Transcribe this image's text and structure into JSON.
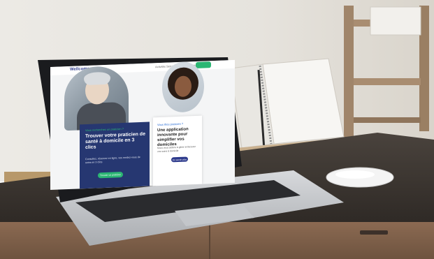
{
  "screen": {
    "logo": "Wellcome",
    "nav_links": "Activités  Services  Nous Rejoindre",
    "card_left": {
      "eyebrow": "Vous recherchez un praticien ?",
      "title": "Trouver votre praticien de santé à domicile en 3 clics",
      "text": "Consultez, réservez en ligne, vos rendez-vous de soins en 3 clics",
      "button": "Trouver un praticien"
    },
    "card_right": {
      "eyebrow": "Vous êtes praticien ?",
      "title": "Une application innovante pour simplifier vos domiciles",
      "text": "Nous vous aidons à gérer et facturer vos soins à domicile",
      "button": "En savoir plus"
    }
  },
  "colors": {
    "card_left_bg": "#263771",
    "accent_green": "#2bb673",
    "button_blue": "#2d3a8c"
  }
}
